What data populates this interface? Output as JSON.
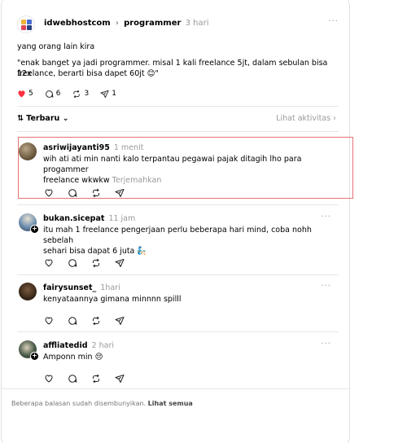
{
  "post": {
    "author": "idwebhostcom",
    "separator": "›",
    "topic": "programmer",
    "time": "3 hari",
    "line1": "yang orang lain kira",
    "line2": "\"enak banget ya jadi programmer. misal 1 kali freelance 5jt, dalam sebulan bisa 12x",
    "line3": "freelance, berarti bisa dapet 60jt 😊\"",
    "more": "···",
    "likes": "5",
    "comments": "6",
    "reposts": "3",
    "shares": "1",
    "colors": {
      "like": "#ff3040"
    }
  },
  "sort": {
    "label": "⇅ Terbaru ⌄",
    "activity": "Lihat aktivitas ›"
  },
  "replies": [
    {
      "author": "asriwijayanti95",
      "time": "1 menit",
      "line1": "wih ati ati min nanti kalo terpantau pegawai pajak ditagih lho para progammer",
      "line2": "freelance wkwkw",
      "translate": "Terjemahkan",
      "more": "···",
      "icons": [
        "heart-icon",
        "comment-icon",
        "repost-icon",
        "share-icon"
      ]
    },
    {
      "author": "bukan.sicepat",
      "time": "11 jam",
      "line1": "itu mah 1 freelance pengerjaan perlu beberapa hari mind, coba nohh sebelah",
      "line2": "sehari bisa dapat 6 juta 🧞",
      "more": "···",
      "icons": [
        "heart-icon",
        "comment-icon",
        "repost-icon",
        "share-icon"
      ]
    },
    {
      "author": "fairysunset_",
      "time": "1hari",
      "line1": "kenyataannya gimana minnnn spilll",
      "more": "···",
      "icons": [
        "heart-icon",
        "comment-icon",
        "repost-icon",
        "share-icon"
      ]
    },
    {
      "author": "affliatedid",
      "time": "2 hari",
      "line1": "Amponn min 😔",
      "more": "···",
      "icons": [
        "heart-icon",
        "comment-icon",
        "repost-icon",
        "share-icon"
      ]
    }
  ],
  "footer": {
    "hidden_note": "Beberapa balasan sudah disembunyikan.",
    "see_all": "Lihat semua"
  }
}
